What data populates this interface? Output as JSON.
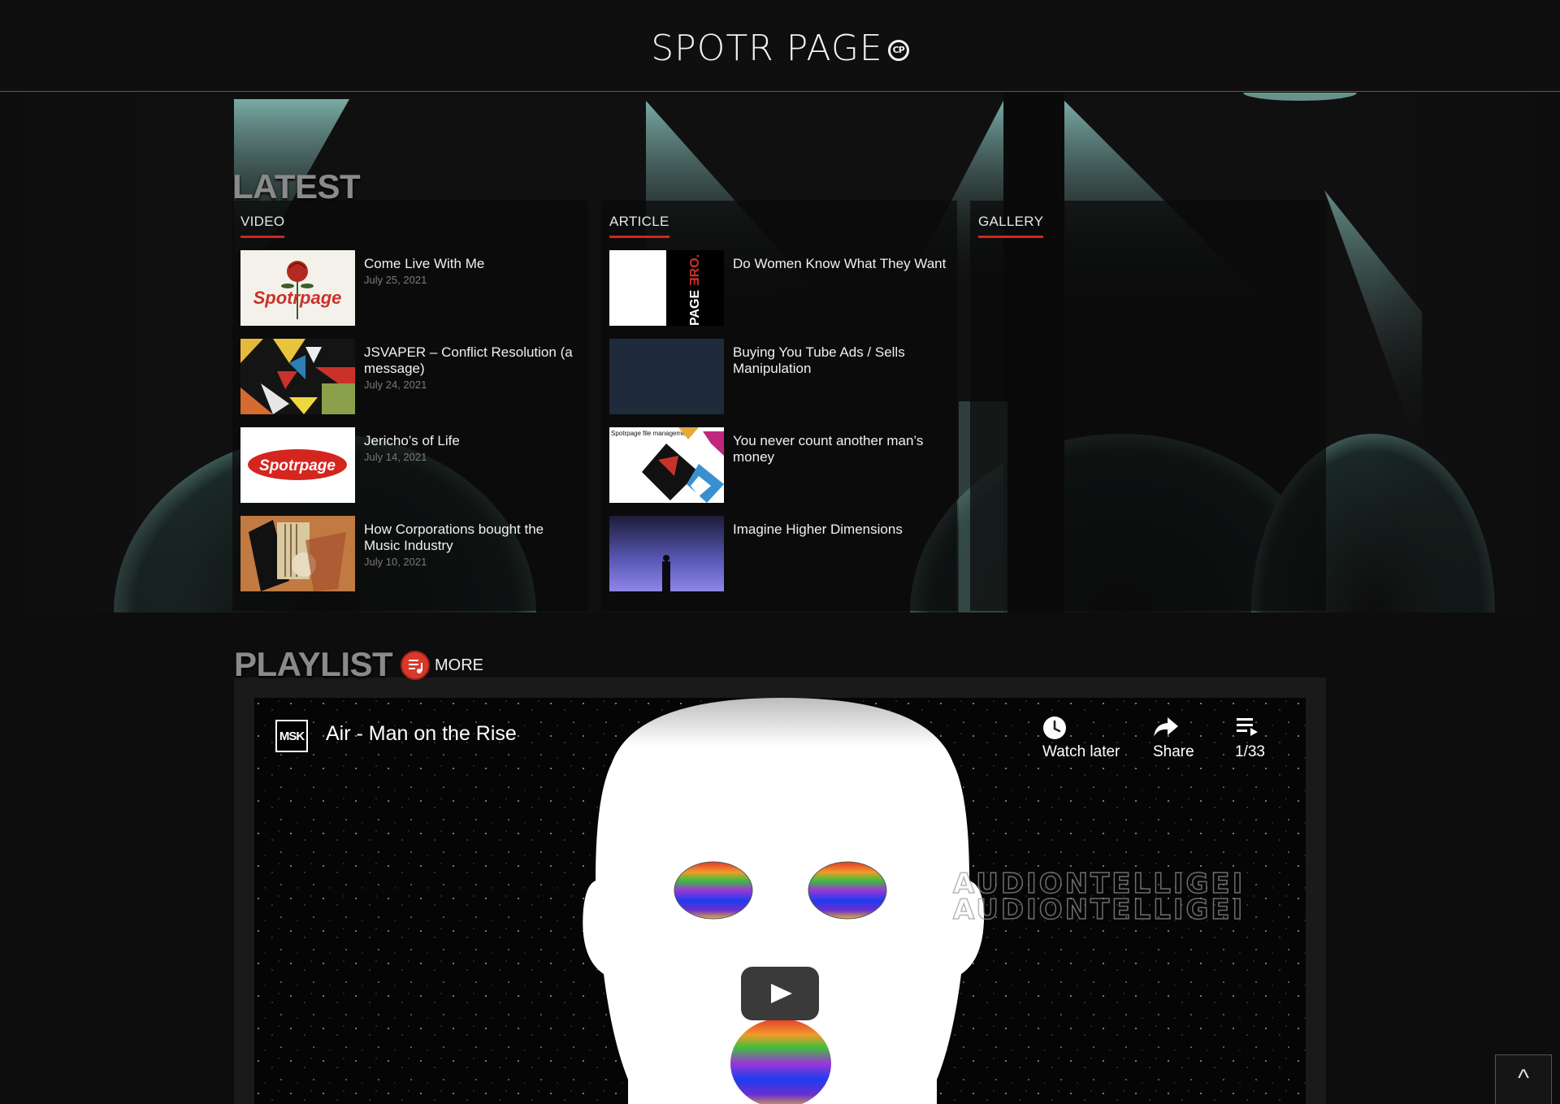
{
  "site": {
    "title": "SPOTR PAGE",
    "logo_mark": "CP"
  },
  "latest": {
    "heading": "LATEST",
    "columns": {
      "video": {
        "tab": "VIDEO",
        "items": [
          {
            "title": "Come Live With Me",
            "date": "July 25, 2021",
            "thumb_text": "Spotrpage"
          },
          {
            "title": "JSVAPER – Conflict Resolution (a message)",
            "date": "July 24, 2021"
          },
          {
            "title": "Jericho’s of Life",
            "date": "July 14, 2021",
            "thumb_text": "Spotrpage"
          },
          {
            "title": "How Corporations bought the Music Industry",
            "date": "July 10, 2021"
          }
        ]
      },
      "article": {
        "tab": "ARTICLE",
        "items": [
          {
            "title": "Do Women Know What They Want",
            "thumb_text": "PAGE",
            "thumb_text_red": "ƎRO."
          },
          {
            "title": "Buying You Tube Ads / Sells Manipulation"
          },
          {
            "title": "You never count another man’s money",
            "thumb_text": "Spotrpage file management."
          },
          {
            "title": "Imagine Higher Dimensions"
          }
        ]
      },
      "gallery": {
        "tab": "GALLERY"
      }
    }
  },
  "playlist": {
    "heading": "PLAYLIST",
    "more_label": "MORE",
    "player": {
      "channel_logo": "MSK",
      "video_title": "Air - Man on the Rise",
      "watch_later_label": "Watch later",
      "share_label": "Share",
      "playlist_position": "1/33",
      "watermark_line1": "AUDIONTELLIGEI",
      "watermark_line2": "AUDIONTELLIGEI"
    }
  },
  "back_to_top_label": "^",
  "colors": {
    "accent": "#d0261d",
    "background": "#0d0d0d",
    "teal": "#7fb3ad"
  }
}
